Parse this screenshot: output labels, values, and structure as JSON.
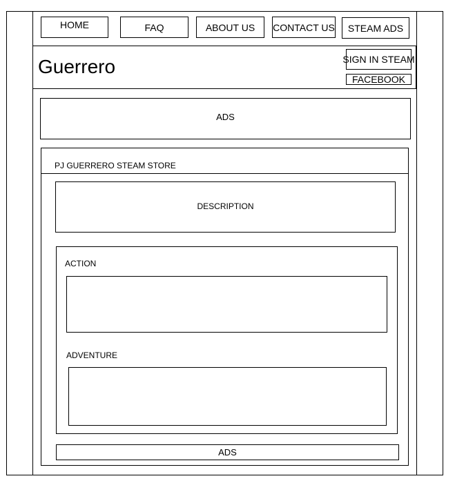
{
  "nav": {
    "items": [
      {
        "label": "HOME"
      },
      {
        "label": "FAQ"
      },
      {
        "label": "ABOUT US"
      },
      {
        "label": "CONTACT US"
      },
      {
        "label": "STEAM ADS"
      }
    ]
  },
  "header": {
    "title": "Guerrero",
    "sign_in": "SIGN IN STEAM",
    "facebook": "FACEBOOK"
  },
  "top_ad": "ADS",
  "store": {
    "title": "PJ GUERRERO STEAM STORE",
    "description": "DESCRIPTION",
    "categories": [
      {
        "label": "ACTION"
      },
      {
        "label": "ADVENTURE"
      }
    ]
  },
  "bottom_ad": "ADS"
}
